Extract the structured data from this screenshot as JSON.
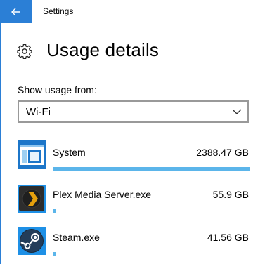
{
  "window": {
    "title": "Settings"
  },
  "header": {
    "title": "Usage details"
  },
  "filter": {
    "label": "Show usage from:",
    "selected": "Wi-Fi"
  },
  "apps": [
    {
      "name": "System",
      "size": "2388.47 GB",
      "usage_fraction": 1.0,
      "icon": "system-window-icon"
    },
    {
      "name": "Plex Media Server.exe",
      "size": "55.9 GB",
      "usage_fraction": 0.023,
      "icon": "plex-icon"
    },
    {
      "name": "Steam.exe",
      "size": "41.56 GB",
      "usage_fraction": 0.017,
      "icon": "steam-icon"
    }
  ],
  "colors": {
    "accent": "#2b7fd6",
    "bar": "#5bb5ea"
  }
}
